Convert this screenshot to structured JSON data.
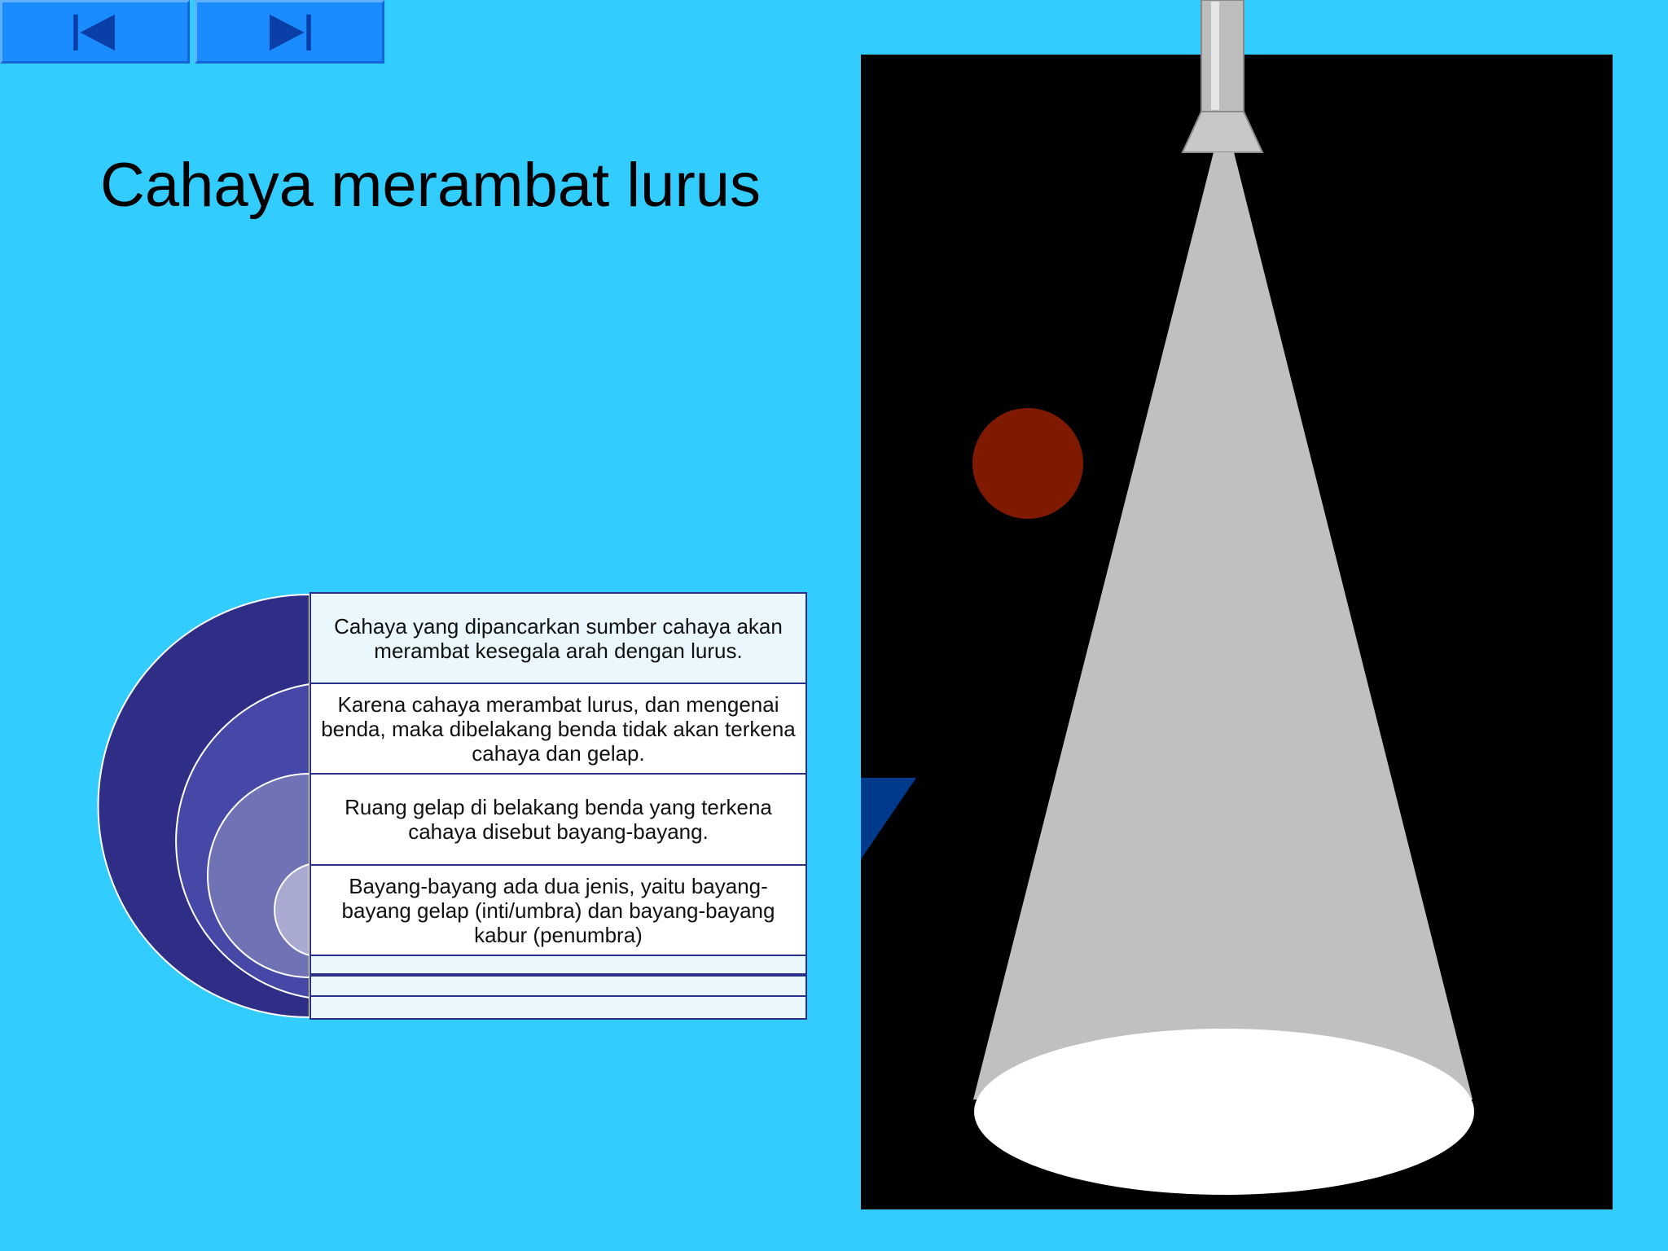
{
  "navigation": {
    "prev_label": "Previous slide",
    "next_label": "Next slide"
  },
  "slide": {
    "title": "Cahaya merambat lurus"
  },
  "panels": [
    "Cahaya yang dipancarkan sumber cahaya akan merambat kesegala arah dengan lurus.",
    "Karena cahaya merambat lurus, dan mengenai benda, maka dibelakang benda tidak akan terkena cahaya dan gelap.",
    "Ruang gelap di belakang benda yang terkena cahaya disebut bayang-bayang.",
    "Bayang-bayang ada dua jenis, yaitu bayang-bayang gelap (inti/umbra) dan bayang-bayang kabur (penumbra)"
  ],
  "colors": {
    "background": "#33ccff",
    "nav_button": "#1a8cff",
    "arc_outer": "#2e2e87",
    "arc_2": "#4548a6",
    "arc_3": "#6f72b5",
    "arc_inner": "#a8aad2",
    "light_beam": "#c0c0c0",
    "object_ball": "#7f1a00",
    "stage": "#000000"
  }
}
